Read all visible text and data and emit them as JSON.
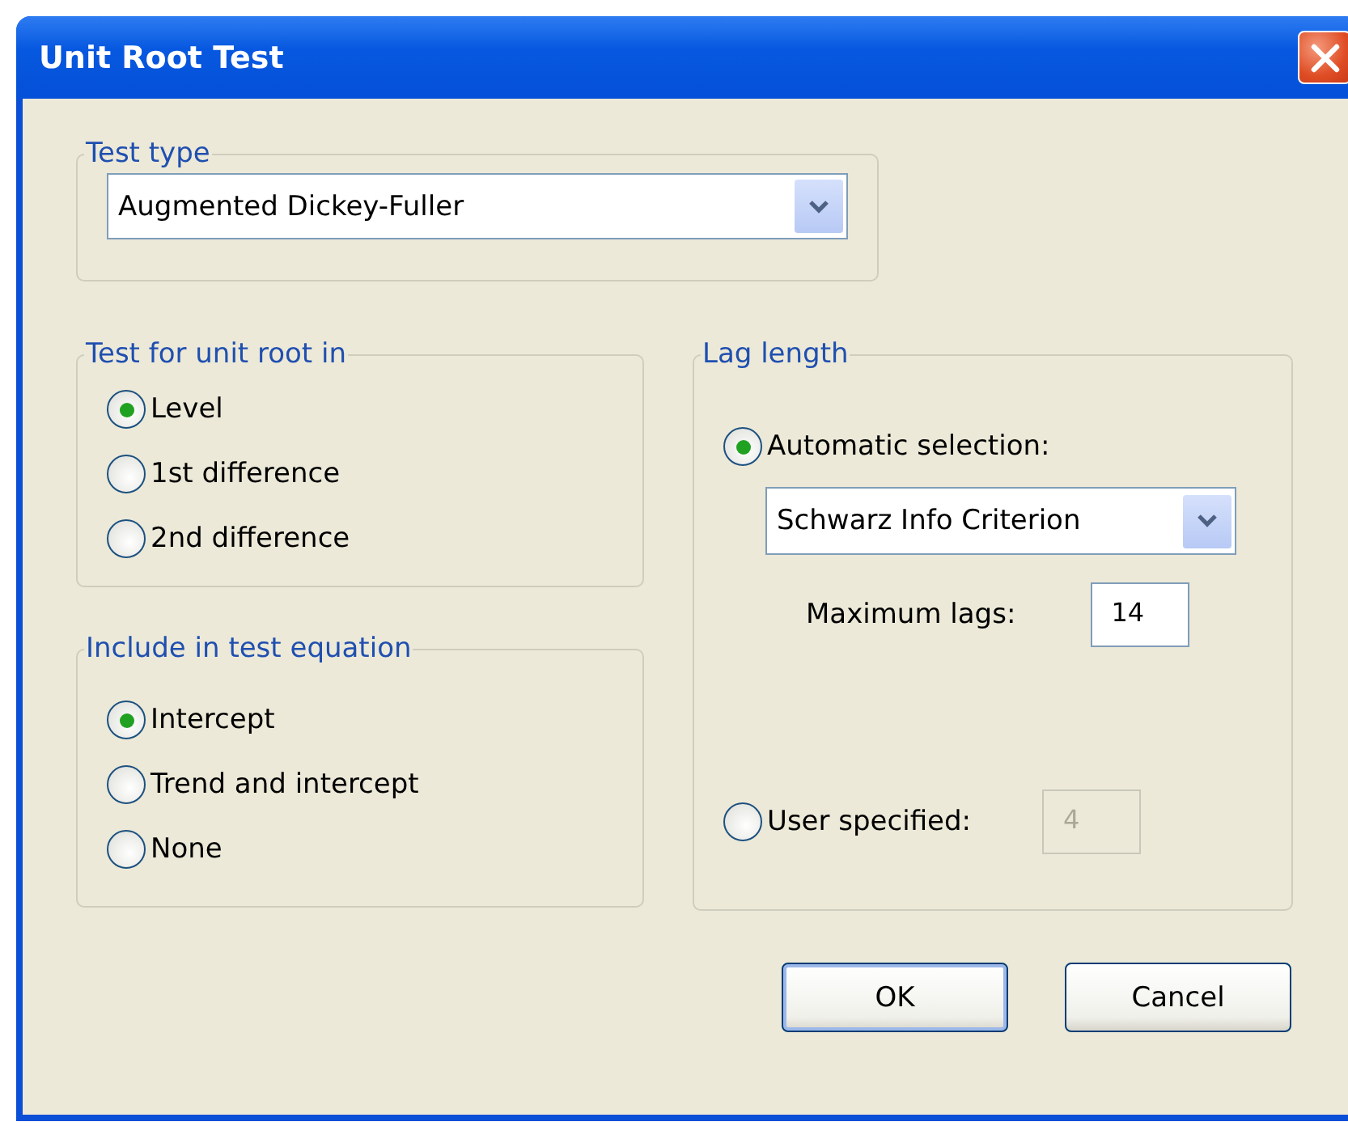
{
  "window": {
    "title": "Unit Root Test"
  },
  "test_type": {
    "legend": "Test type",
    "dropdown": {
      "value": "Augmented Dickey-Fuller"
    }
  },
  "unit_root_in": {
    "legend": "Test for unit root in",
    "options": [
      {
        "label": "Level",
        "selected": true
      },
      {
        "label": "1st difference",
        "selected": false
      },
      {
        "label": "2nd difference",
        "selected": false
      }
    ]
  },
  "test_equation": {
    "legend": "Include in test equation",
    "options": [
      {
        "label": "Intercept",
        "selected": true
      },
      {
        "label": "Trend and intercept",
        "selected": false
      },
      {
        "label": "None",
        "selected": false
      }
    ]
  },
  "lag_length": {
    "legend": "Lag length",
    "automatic": {
      "label": "Automatic selection:",
      "selected": true,
      "dropdown": {
        "value": "Schwarz Info Criterion"
      },
      "max_lags": {
        "label": "Maximum lags:",
        "value": "14",
        "disabled": false
      }
    },
    "user_specified": {
      "label": "User specified:",
      "selected": false,
      "value": "4",
      "disabled": true
    }
  },
  "buttons": [
    {
      "label": "OK",
      "default": true
    },
    {
      "label": "Cancel",
      "default": false
    }
  ]
}
